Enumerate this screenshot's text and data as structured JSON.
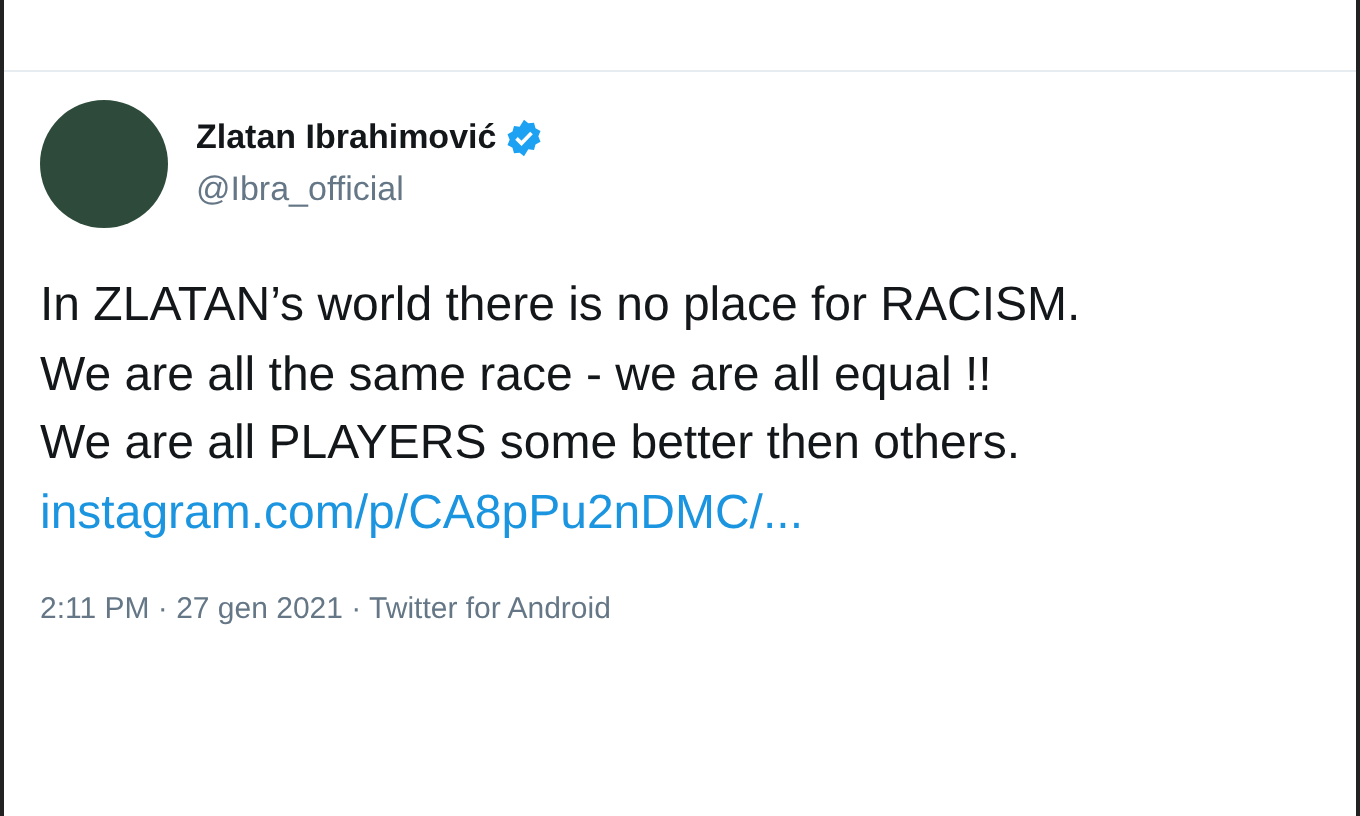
{
  "author": {
    "name": "Zlatan Ibrahimović",
    "verified": true,
    "handle": "@Ibra_official"
  },
  "tweet": {
    "lines": [
      "In ZLATAN’s world there is no place for RACISM.",
      "We are all the same race - we are all equal !!",
      "We are all PLAYERS some better then others."
    ],
    "link": "instagram.com/p/CA8pPu2nDMC/..."
  },
  "meta": {
    "time": "2:11 PM · 27 gen 2021 · Twitter for Android"
  }
}
